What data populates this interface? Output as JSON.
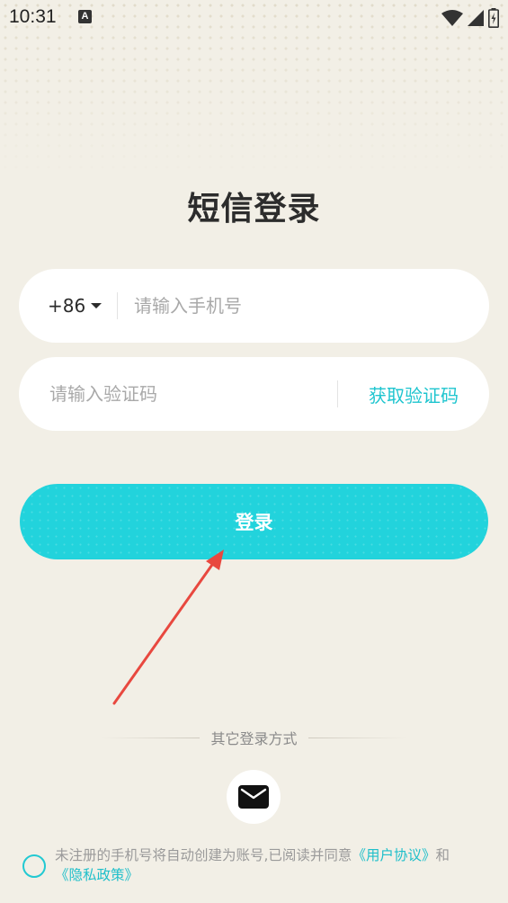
{
  "status_bar": {
    "time": "10:31",
    "notification_letter": "A",
    "icons": [
      "wifi-icon",
      "signal-icon",
      "battery-icon"
    ]
  },
  "page": {
    "title": "短信登录"
  },
  "phone_field": {
    "country_code": "+86",
    "placeholder": "请输入手机号",
    "value": ""
  },
  "code_field": {
    "placeholder": "请输入验证码",
    "value": "",
    "get_code_label": "获取验证码"
  },
  "login_button": {
    "label": "登录"
  },
  "other_login": {
    "label": "其它登录方式",
    "methods": [
      "email-icon"
    ]
  },
  "agreement": {
    "checked": false,
    "text": "未注册的手机号将自动创建为账号,已阅读并同意",
    "user_agreement": "《用户协议》",
    "and": "和",
    "privacy_policy": "《隐私政策》"
  },
  "colors": {
    "background": "#f2efe6",
    "accent": "#22d3dc",
    "link": "#1fbfca",
    "annotation_arrow": "#e8483f"
  }
}
